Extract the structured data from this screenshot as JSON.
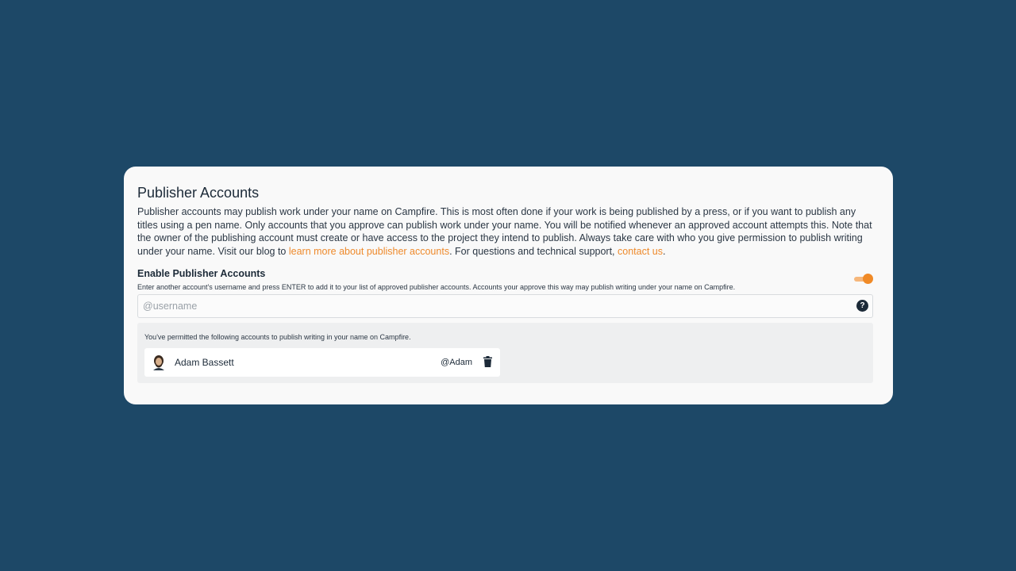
{
  "card": {
    "title": "Publisher Accounts",
    "description": {
      "part1": "Publisher accounts may publish work under your name on Campfire. This is most often done if your work is being published by a press, or if you want to publish any titles using a pen name. Only accounts that you approve can publish work under your name. You will be notified whenever an approved account attempts this. Note that the owner of the publishing account must create or have access to the project they intend to publish. Always take care with who you give permission to publish writing under your name. Visit our blog to ",
      "link1": "learn more about publisher accounts",
      "part2": ". For questions and technical support, ",
      "link2": "contact us",
      "part3": "."
    }
  },
  "enable_section": {
    "title": "Enable Publisher Accounts",
    "help_text": "Enter another account's username and press ENTER to add it to your list of approved publisher accounts. Accounts your approve this way may publish writing under your name on Campfire.",
    "toggle_on": true
  },
  "username_input": {
    "placeholder": "@username",
    "value": "",
    "help_icon": "?"
  },
  "permitted": {
    "text": "You've permitted the following accounts to publish writing in your name on Campfire.",
    "accounts": [
      {
        "name": "Adam Bassett",
        "handle": "@Adam",
        "avatar_icon": "avatar-icon"
      }
    ]
  },
  "colors": {
    "background": "#1d4867",
    "accent": "#ee8a2c",
    "text": "#1c2a38"
  }
}
